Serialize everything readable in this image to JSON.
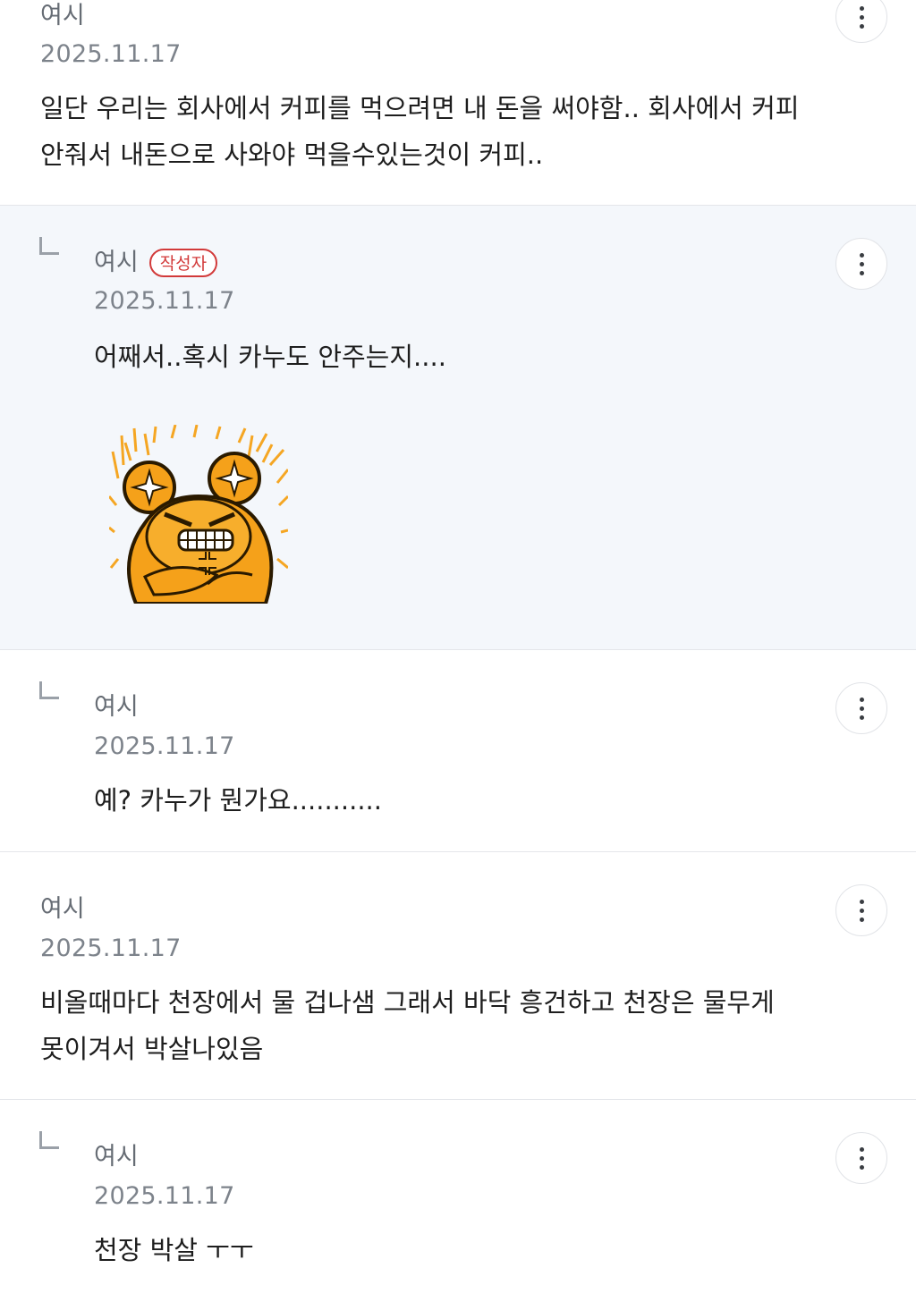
{
  "comments": [
    {
      "author": "여시",
      "date": "2025.11.17",
      "text": "일단 우리는 회사에서 커피를 먹으려면 내 돈을 써야함.. 회사에서 커피\n안줘서 내돈으로 사와야 먹을수있는것이 커피..",
      "icons": {
        "more": "more-vertical-icon"
      }
    },
    {
      "author": "여시",
      "badge": "작성자",
      "date": "2025.11.17",
      "text": "어째서..혹시 카누도 안주는지....",
      "sticker": "angry-bear-sticker",
      "icons": {
        "reply": "reply-arrow-icon",
        "more": "more-vertical-icon"
      }
    },
    {
      "author": "여시",
      "date": "2025.11.17",
      "text": "예? 카누가 뭔가요...........",
      "icons": {
        "reply": "reply-arrow-icon",
        "more": "more-vertical-icon"
      }
    },
    {
      "author": "여시",
      "date": "2025.11.17",
      "text": "비올때마다 천장에서 물 겁나샘 그래서 바닥 흥건하고 천장은 물무게\n못이겨서 박살나있음",
      "icons": {
        "more": "more-vertical-icon"
      }
    },
    {
      "author": "여시",
      "date": "2025.11.17",
      "text": "천장 박살 ㅜㅜ",
      "icons": {
        "reply": "reply-arrow-icon",
        "more": "more-vertical-icon"
      }
    }
  ],
  "colors": {
    "highlight_bg": "#f4f7fb",
    "badge_red": "#d23a3a",
    "divider": "#e4e6ea"
  }
}
